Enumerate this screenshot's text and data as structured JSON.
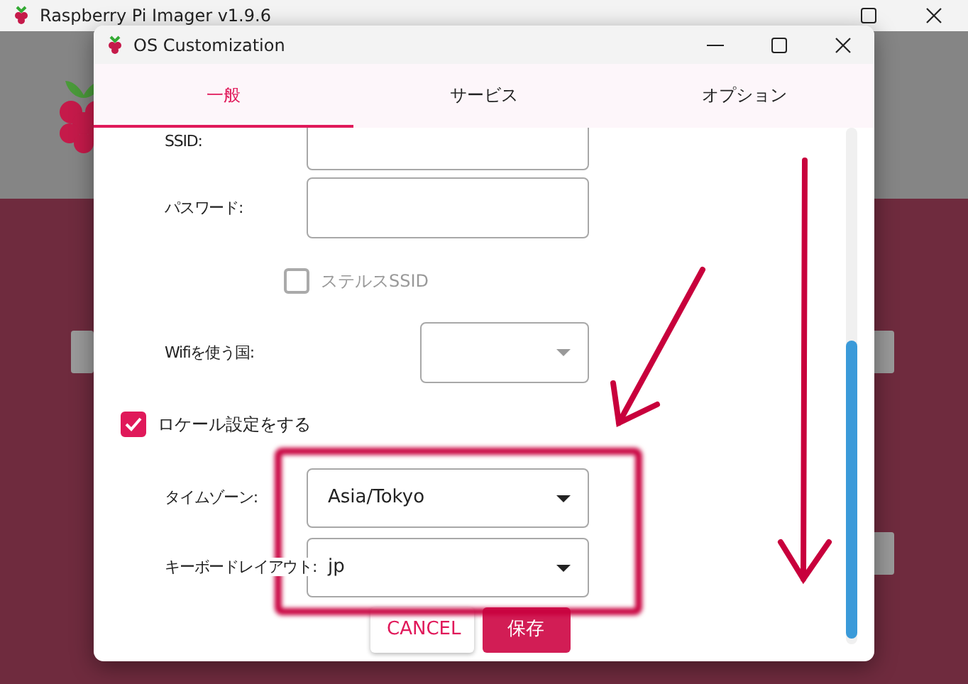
{
  "main_window": {
    "title": "Raspberry Pi Imager v1.9.6"
  },
  "dialog": {
    "title": "OS Customization"
  },
  "tabs": [
    {
      "label": "一般",
      "selected": true
    },
    {
      "label": "サービス",
      "selected": false
    },
    {
      "label": "オプション",
      "selected": false
    }
  ],
  "fields": [
    {
      "kind": "text",
      "label": "SSID:"
    },
    {
      "kind": "text",
      "label": "パスワード:"
    },
    {
      "kind": "sub-checkbox",
      "label": "ステルスSSID",
      "checked": false,
      "disabled": true
    },
    {
      "kind": "short-select",
      "label": "Wifiを使う国:"
    },
    {
      "kind": "checkbox",
      "label": "ロケール設定をする",
      "checked": true,
      "disabled": false
    },
    {
      "kind": "select",
      "label": "タイムゾーン:",
      "value": "Asia/Tokyo"
    },
    {
      "kind": "select",
      "label": "キーボードレイアウト:",
      "value": "jp"
    }
  ],
  "buttons": [
    {
      "label": "CANCEL",
      "kind": "secondary"
    },
    {
      "label": "保存",
      "kind": "primary"
    }
  ]
}
